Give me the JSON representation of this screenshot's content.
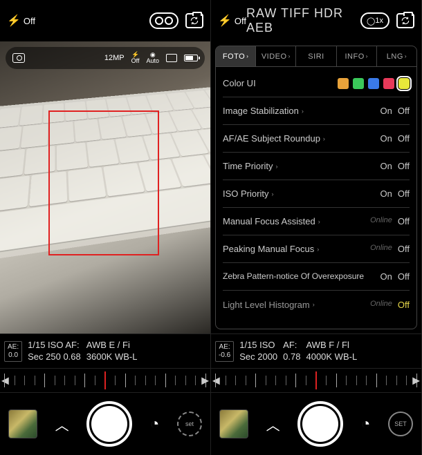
{
  "left": {
    "topbar": {
      "flash_label": "Off"
    },
    "infobar": {
      "resolution": "12MP",
      "flash_mode": "Off",
      "shoot_mode": "Auto"
    },
    "readout": {
      "ae_label": "AE:",
      "ae_value": "0.0",
      "line1": "1/15 ISO AF:",
      "line2": "Sec 250 0.68",
      "wb1": "AWB E / Fi",
      "wb2": "3600K WB-L"
    },
    "bottom": {
      "set_label": "set"
    }
  },
  "right": {
    "topbar": {
      "flash_label": "Off",
      "modes": "RAW TIFF HDR AEB",
      "zoom": "1x"
    },
    "tabs": [
      "FOTO",
      "VIDEO",
      "SIRI",
      "INFO",
      "LNG"
    ],
    "rows": {
      "color_ui": "Color UI",
      "swatches": [
        "#e8a23a",
        "#3ac85a",
        "#3a7ae8",
        "#e83a5a",
        "#e8e83a"
      ],
      "stabilization": {
        "label": "Image Stabilization",
        "on": "On",
        "off": "Off"
      },
      "afae": {
        "label": "AF/AE Subject Roundup",
        "on": "On",
        "off": "Off"
      },
      "time_priority": {
        "label": "Time Priority",
        "on": "On",
        "off": "Off"
      },
      "iso_priority": {
        "label": "ISO Priority",
        "on": "On",
        "off": "Off"
      },
      "manual_focus": {
        "label": "Manual Focus Assisted",
        "hint": "Online",
        "off": "Off"
      },
      "peaking": {
        "label": "Peaking Manual Focus",
        "hint": "Online",
        "off": "Off"
      },
      "zebra": {
        "label": "Zebra Pattern-notice Of Overexposure",
        "on": "On",
        "off": "Off"
      },
      "histogram": {
        "label": "Light Level Histogram",
        "hint": "Online",
        "off": "Off"
      }
    },
    "readout": {
      "ae_label": "AE:",
      "ae_value": "-0.6",
      "line1": "1/15 ISO",
      "line2": "Sec 2000",
      "af1": "AF:",
      "af2": "0.78",
      "wb1": "AWB F / Fl",
      "wb2": "4000K WB-L"
    },
    "bottom": {
      "set_label": "SET"
    }
  }
}
